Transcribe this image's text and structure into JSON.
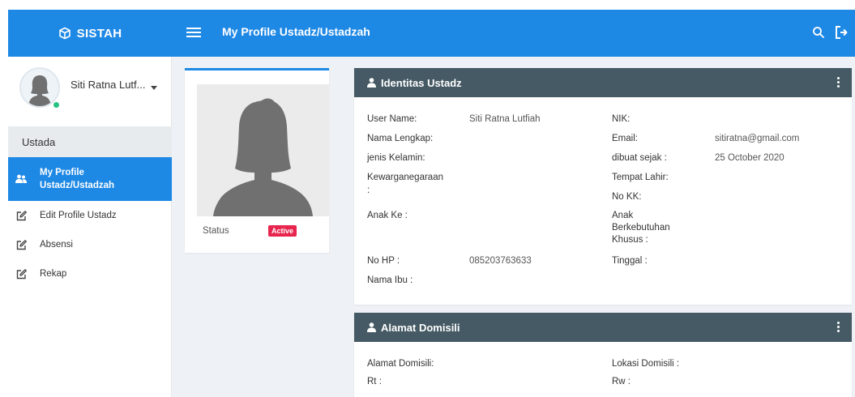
{
  "header": {
    "brand": "SISTAH",
    "title": "My Profile Ustadz/Ustadzah"
  },
  "user": {
    "name": "Siti Ratna Lutf..."
  },
  "sidebar": {
    "section": "Ustada",
    "items": [
      {
        "label": "My Profile Ustadz/Ustadzah",
        "icon": "users-icon",
        "active": true
      },
      {
        "label": "Edit Profile Ustadz",
        "icon": "edit-icon"
      },
      {
        "label": "Absensi",
        "icon": "edit-icon"
      },
      {
        "label": "Rekap",
        "icon": "edit-icon"
      }
    ]
  },
  "status_card": {
    "label": "Status",
    "badge": "Active"
  },
  "identitas": {
    "title": "Identitas Ustadz",
    "user_name_label": "User Name:",
    "user_name_value": "Siti Ratna Lutfiah",
    "nama_lengkap_label": "Nama Lengkap:",
    "jenis_kelamin_label": "jenis Kelamin:",
    "kewarganegaraan_label": "Kewarganegaraan",
    "kewarganegaraan_colon": ":",
    "anak_ke_label": "Anak Ke :",
    "no_hp_label": "No HP :",
    "no_hp_value": "085203763633",
    "nama_ibu_label": "Nama Ibu :",
    "nik_label": "NIK:",
    "email_label": "Email:",
    "email_value": "sitiratna@gmail.com",
    "dibuat_sejak_label": "dibuat sejak :",
    "dibuat_sejak_value": "25 October 2020",
    "tempat_lahir_label": "Tempat Lahir:",
    "no_kk_label": "No KK:",
    "abk_line1": "Anak",
    "abk_line2": "Berkebutuhan",
    "abk_line3": "Khusus :",
    "tinggal_label": "Tinggal :"
  },
  "alamat": {
    "title": "Alamat Domisili",
    "alamat_label": "Alamat Domisili:",
    "rt_label": "Rt :",
    "lokasi_label": "Lokasi Domisili :",
    "rw_label": "Rw :"
  },
  "colors": {
    "primary": "#1e88e5",
    "card_header": "#455a64",
    "badge": "#e7254e",
    "background": "#eef1f5"
  }
}
